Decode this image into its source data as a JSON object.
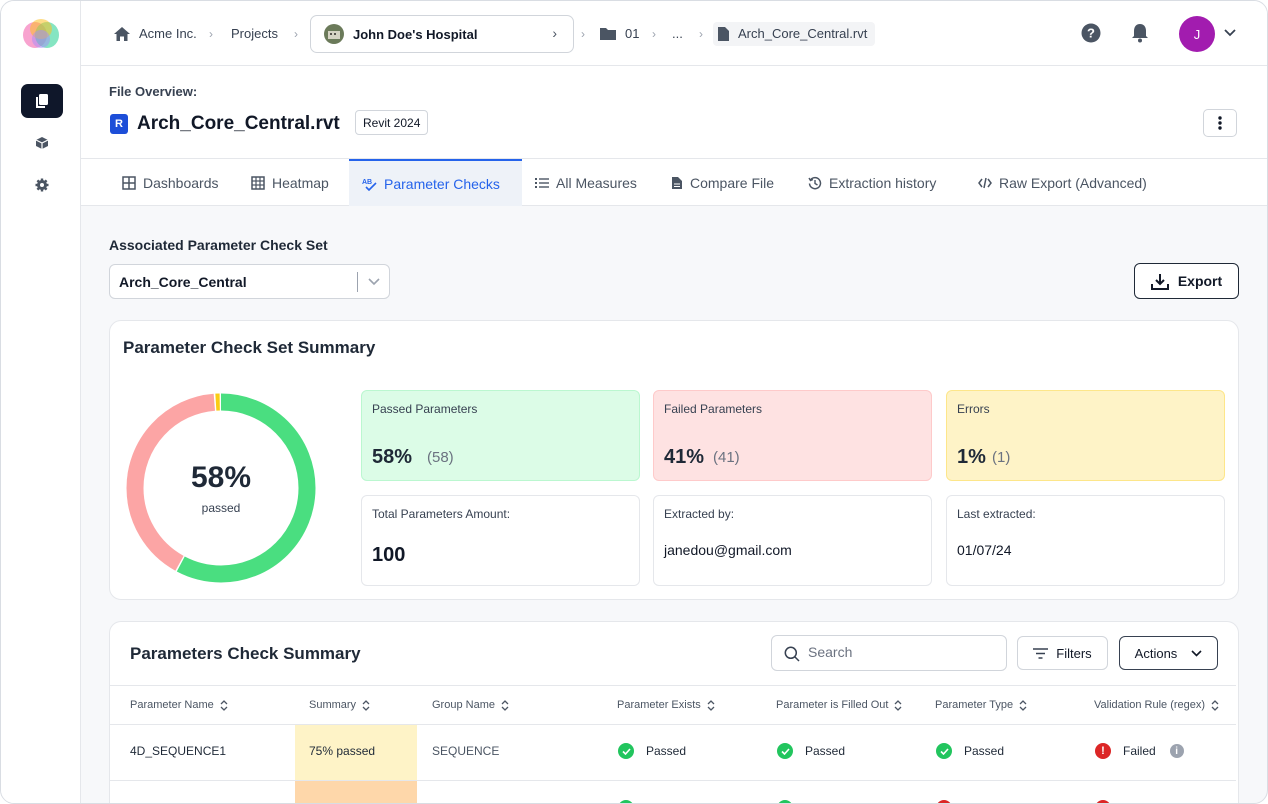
{
  "breadcrumbs": {
    "org": "Acme Inc.",
    "projects": "Projects",
    "project": "John Doe's Hospital",
    "folder": "01",
    "ellipsis": "...",
    "file": "Arch_Core_Central.rvt"
  },
  "user": {
    "initial": "J"
  },
  "file_overview": {
    "label": "File Overview:",
    "title": "Arch_Core_Central.rvt",
    "badge": "R",
    "version": "Revit 2024"
  },
  "tabs": [
    {
      "label": "Dashboards",
      "icon": "grid-icon"
    },
    {
      "label": "Heatmap",
      "icon": "table-icon"
    },
    {
      "label": "Parameter Checks",
      "icon": "spellcheck-icon",
      "active": true
    },
    {
      "label": "All Measures",
      "icon": "list-icon"
    },
    {
      "label": "Compare File",
      "icon": "file-icon"
    },
    {
      "label": "Extraction history",
      "icon": "history-icon"
    },
    {
      "label": "Raw Export (Advanced)",
      "icon": "code-icon"
    }
  ],
  "check_set": {
    "label": "Associated Parameter Check Set",
    "selected": "Arch_Core_Central"
  },
  "export_label": "Export",
  "summary": {
    "title": "Parameter Check Set Summary",
    "donut": {
      "center_value": "58%",
      "center_label": "passed",
      "passed_fraction": 0.58,
      "failed_fraction": 0.41,
      "errors_fraction": 0.01,
      "colors": {
        "passed": "#4ade80",
        "failed": "#fca5a5",
        "errors": "#facc15"
      }
    },
    "passed": {
      "label": "Passed Parameters",
      "pct": "58%",
      "count": "(58)"
    },
    "failed": {
      "label": "Failed Parameters",
      "pct": "41%",
      "count": "(41)"
    },
    "errors": {
      "label": "Errors",
      "pct": "1%",
      "count": "(1)"
    },
    "total": {
      "label": "Total Parameters Amount:",
      "value": "100"
    },
    "extracted_by": {
      "label": "Extracted by:",
      "value": "janedou@gmail.com"
    },
    "last_extracted": {
      "label": "Last extracted:",
      "value": "01/07/24"
    }
  },
  "table": {
    "title": "Parameters Check Summary",
    "search_placeholder": "Search",
    "filters_label": "Filters",
    "actions_label": "Actions",
    "columns": [
      "Parameter Name",
      "Summary",
      "Group Name",
      "Parameter Exists",
      "Parameter is Filled Out",
      "Parameter Type",
      "Validation Rule (regex)"
    ],
    "rows": [
      {
        "name": "4D_SEQUENCE1",
        "summary": "75% passed",
        "group": "SEQUENCE",
        "exists": "Passed",
        "filled": "Passed",
        "type": "Passed",
        "regex": "Failed"
      }
    ]
  },
  "colors": {
    "accent": "#2563eb",
    "pass": "#22c55e",
    "fail": "#dc2626",
    "summary_highlight": "#fef3c7",
    "avatar": "#a21caf"
  }
}
